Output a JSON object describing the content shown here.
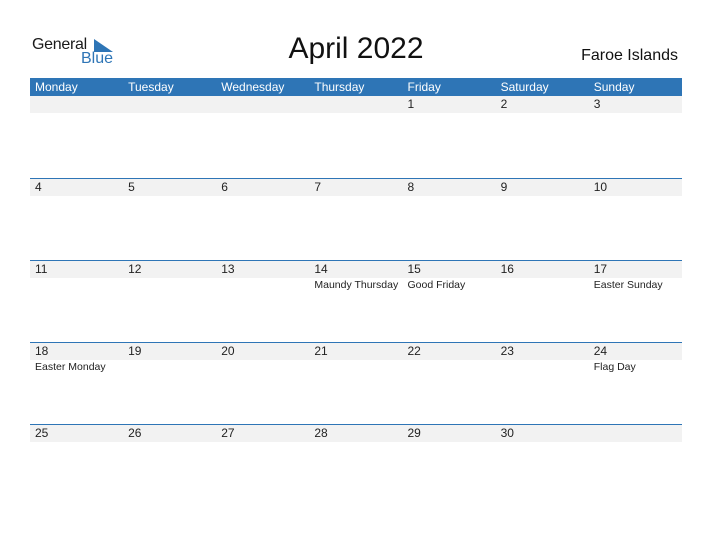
{
  "logo": {
    "word1": "General",
    "word2": "Blue"
  },
  "title": "April 2022",
  "country": "Faroe Islands",
  "colors": {
    "accent": "#2e75b6",
    "strip": "#f2f2f2"
  },
  "weekdays": [
    "Monday",
    "Tuesday",
    "Wednesday",
    "Thursday",
    "Friday",
    "Saturday",
    "Sunday"
  ],
  "weeks": [
    [
      {
        "day": "",
        "holiday": ""
      },
      {
        "day": "",
        "holiday": ""
      },
      {
        "day": "",
        "holiday": ""
      },
      {
        "day": "",
        "holiday": ""
      },
      {
        "day": "1",
        "holiday": ""
      },
      {
        "day": "2",
        "holiday": ""
      },
      {
        "day": "3",
        "holiday": ""
      }
    ],
    [
      {
        "day": "4",
        "holiday": ""
      },
      {
        "day": "5",
        "holiday": ""
      },
      {
        "day": "6",
        "holiday": ""
      },
      {
        "day": "7",
        "holiday": ""
      },
      {
        "day": "8",
        "holiday": ""
      },
      {
        "day": "9",
        "holiday": ""
      },
      {
        "day": "10",
        "holiday": ""
      }
    ],
    [
      {
        "day": "11",
        "holiday": ""
      },
      {
        "day": "12",
        "holiday": ""
      },
      {
        "day": "13",
        "holiday": ""
      },
      {
        "day": "14",
        "holiday": "Maundy Thursday"
      },
      {
        "day": "15",
        "holiday": "Good Friday"
      },
      {
        "day": "16",
        "holiday": ""
      },
      {
        "day": "17",
        "holiday": "Easter Sunday"
      }
    ],
    [
      {
        "day": "18",
        "holiday": "Easter Monday"
      },
      {
        "day": "19",
        "holiday": ""
      },
      {
        "day": "20",
        "holiday": ""
      },
      {
        "day": "21",
        "holiday": ""
      },
      {
        "day": "22",
        "holiday": ""
      },
      {
        "day": "23",
        "holiday": ""
      },
      {
        "day": "24",
        "holiday": "Flag Day"
      }
    ],
    [
      {
        "day": "25",
        "holiday": ""
      },
      {
        "day": "26",
        "holiday": ""
      },
      {
        "day": "27",
        "holiday": ""
      },
      {
        "day": "28",
        "holiday": ""
      },
      {
        "day": "29",
        "holiday": ""
      },
      {
        "day": "30",
        "holiday": ""
      },
      {
        "day": "",
        "holiday": ""
      }
    ]
  ]
}
